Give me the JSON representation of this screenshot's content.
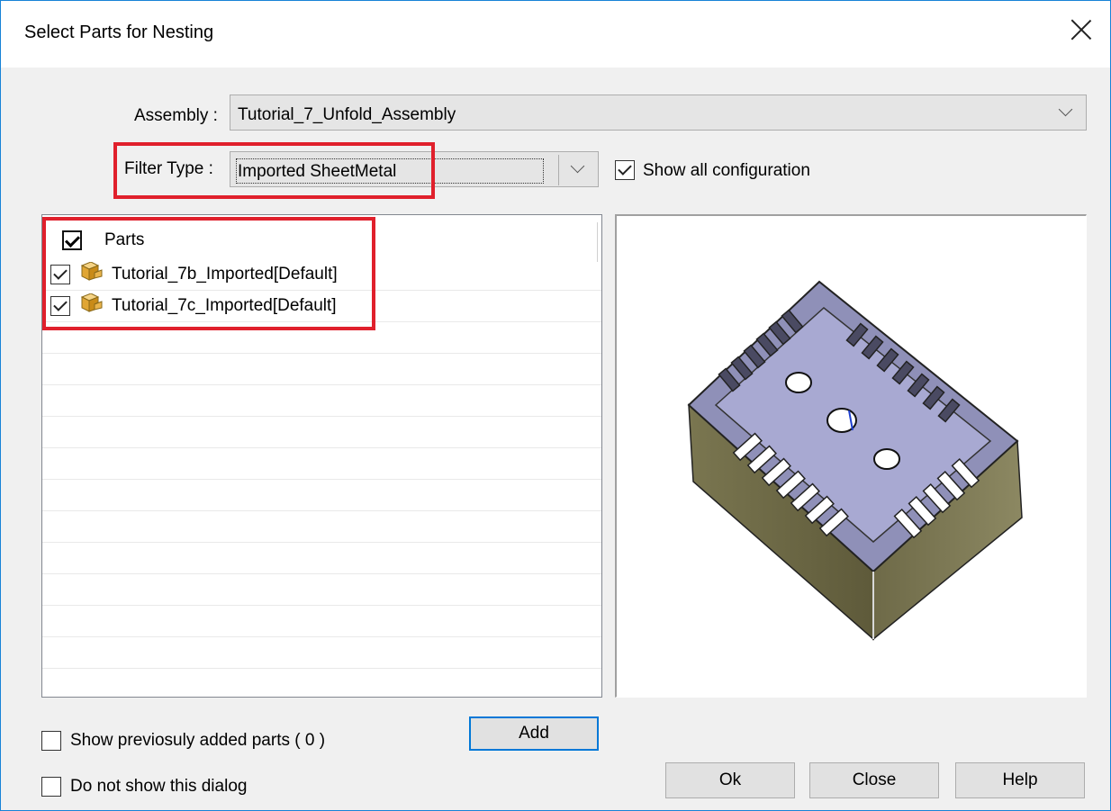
{
  "window": {
    "title": "Select Parts for Nesting"
  },
  "assembly": {
    "label": "Assembly :",
    "value": "Tutorial_7_Unfold_Assembly"
  },
  "filter": {
    "label": "Filter Type :",
    "value": "Imported SheetMetal"
  },
  "show_all_config": {
    "label": "Show all configuration",
    "checked": true
  },
  "parts_tree": {
    "header": {
      "label": "Parts",
      "checked": true
    },
    "items": [
      {
        "label": "Tutorial_7b_Imported[Default]",
        "checked": true,
        "icon": "sheetmetal-part-icon"
      },
      {
        "label": "Tutorial_7c_Imported[Default]",
        "checked": true,
        "icon": "sheetmetal-part-icon"
      }
    ]
  },
  "preview": {
    "icon": "part-preview-3d"
  },
  "options": {
    "show_previous": {
      "label": "Show previosuly added parts ( 0 )",
      "checked": false
    },
    "do_not_show": {
      "label": "Do not show this dialog",
      "checked": false
    }
  },
  "buttons": {
    "add": "Add",
    "ok": "Ok",
    "close": "Close",
    "help": "Help"
  },
  "colors": {
    "highlight": "#e0202c",
    "accent": "#0078d7"
  }
}
